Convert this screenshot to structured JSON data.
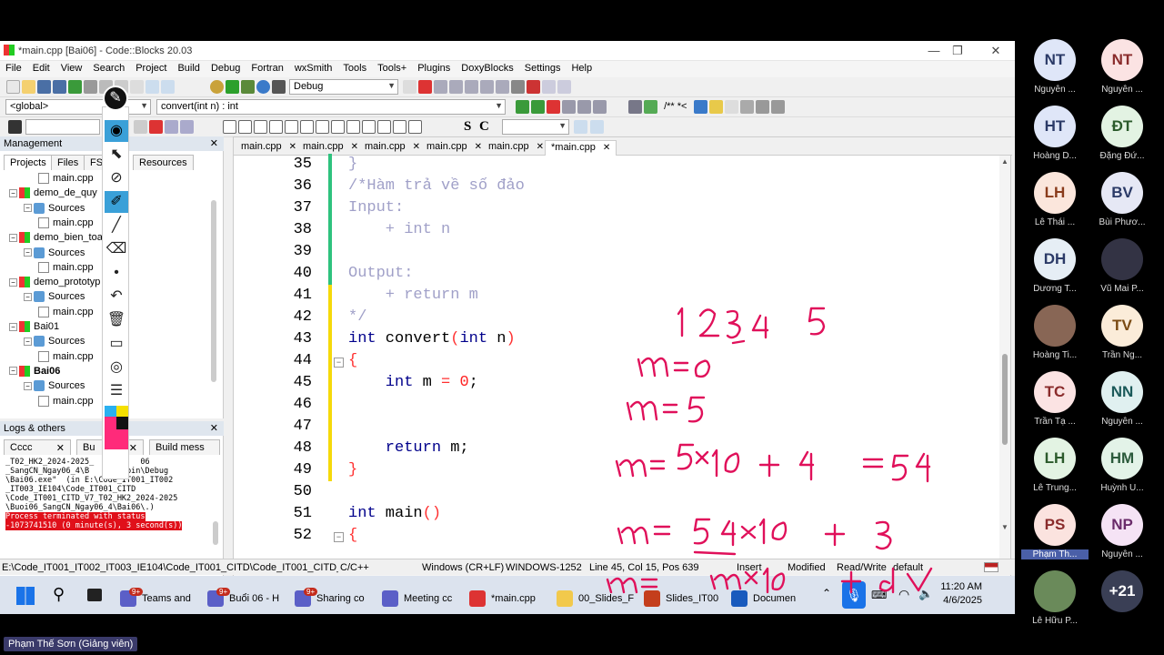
{
  "window": {
    "title": "*main.cpp [Bai06] - Code::Blocks 20.03"
  },
  "menu": [
    "File",
    "Edit",
    "View",
    "Search",
    "Project",
    "Build",
    "Debug",
    "Fortran",
    "wxSmith",
    "Tools",
    "Tools+",
    "Plugins",
    "DoxyBlocks",
    "Settings",
    "Help"
  ],
  "toolbar": {
    "build_target": "Debug",
    "scope": "<global>",
    "function": "convert(int n) : int",
    "comment_btn": "/** *<"
  },
  "management": {
    "title": "Management",
    "tabs": [
      "Projects",
      "Files",
      "FSy",
      "Resources"
    ],
    "tree": [
      {
        "label": "main.cpp",
        "type": "file",
        "indent": 2
      },
      {
        "label": "demo_de_quy",
        "type": "project",
        "indent": 0
      },
      {
        "label": "Sources",
        "type": "folder",
        "indent": 1
      },
      {
        "label": "main.cpp",
        "type": "file",
        "indent": 2
      },
      {
        "label": "demo_bien_toan",
        "type": "project",
        "indent": 0
      },
      {
        "label": "Sources",
        "type": "folder",
        "indent": 1
      },
      {
        "label": "main.cpp",
        "type": "file",
        "indent": 2
      },
      {
        "label": "demo_prototyp",
        "type": "project",
        "indent": 0
      },
      {
        "label": "Sources",
        "type": "folder",
        "indent": 1
      },
      {
        "label": "main.cpp",
        "type": "file",
        "indent": 2
      },
      {
        "label": "Bai01",
        "type": "project",
        "indent": 0
      },
      {
        "label": "Sources",
        "type": "folder",
        "indent": 1
      },
      {
        "label": "main.cpp",
        "type": "file",
        "indent": 2
      },
      {
        "label": "Bai06",
        "type": "project",
        "indent": 0,
        "bold": true
      },
      {
        "label": "Sources",
        "type": "folder",
        "indent": 1
      },
      {
        "label": "main.cpp",
        "type": "file",
        "indent": 2
      }
    ]
  },
  "logs": {
    "title": "Logs & others",
    "tabs": [
      "Cccc",
      "Bu",
      "Build mess"
    ],
    "lines": [
      "_T02_HK2_2024-2025_          06",
      "_SangCN_Ngay06_4\\B        bin\\Debug",
      "\\Bai06.exe\"  (in E:\\Code_IT001_IT002",
      "_IT003_IE104\\Code_IT001_CITD",
      "\\Code_IT001_CITD_V7_T02_HK2_2024-2025",
      "\\Buoi06_SangCN_Ngay06_4\\Bai06\\.)"
    ],
    "highlight": [
      "Process terminated with status",
      "-1073741510 (0 minute(s), 3 second(s))"
    ]
  },
  "editor": {
    "tabs": [
      "main.cpp",
      "main.cpp",
      "main.cpp",
      "main.cpp",
      "main.cpp",
      "*main.cpp"
    ],
    "lines": [
      {
        "n": "35",
        "t": "}",
        "c": "cm"
      },
      {
        "n": "36",
        "t": "/*Hàm trả về số đảo",
        "c": "cm"
      },
      {
        "n": "37",
        "t": "Input:",
        "c": "cm"
      },
      {
        "n": "38",
        "t": "    + int n",
        "c": "cm"
      },
      {
        "n": "39",
        "t": "",
        "c": "cm"
      },
      {
        "n": "40",
        "t": "Output:",
        "c": "cm"
      },
      {
        "n": "41",
        "t": "    + return m",
        "c": "cm"
      },
      {
        "n": "42",
        "t": "*/",
        "c": "cm"
      },
      {
        "n": "43",
        "t": "",
        "c": "code43"
      },
      {
        "n": "44",
        "t": "{",
        "c": "op"
      },
      {
        "n": "45",
        "t": "",
        "c": "code45"
      },
      {
        "n": "46",
        "t": "",
        "c": ""
      },
      {
        "n": "47",
        "t": "",
        "c": ""
      },
      {
        "n": "48",
        "t": "",
        "c": "code48"
      },
      {
        "n": "49",
        "t": "}",
        "c": "op"
      },
      {
        "n": "50",
        "t": "",
        "c": ""
      },
      {
        "n": "51",
        "t": "",
        "c": "code51"
      },
      {
        "n": "52",
        "t": "{",
        "c": "op"
      }
    ],
    "code43": {
      "kw1": "int",
      "fn": " convert",
      "p1": "(",
      "kw2": "int",
      "arg": " n",
      "p2": ")"
    },
    "code45": {
      "kw": "    int",
      "v": " m ",
      "eq": "=",
      "sp": " ",
      "num": "0",
      "semi": ";"
    },
    "code48": {
      "kw": "    return",
      "v": " m;"
    },
    "code51": {
      "kw": "int",
      "fn": " main",
      "p": "()"
    }
  },
  "status": {
    "path": "E:\\Code_IT001_IT002_IT003_IE104\\Code_IT001_CITD\\Code_IT001_CITD_V7_T02...",
    "lang": "C/C++",
    "eol": "Windows (CR+LF)",
    "enc": "WINDOWS-1252",
    "pos": "Line 45, Col 15, Pos 639",
    "mode": "Insert",
    "modified": "Modified",
    "rw": "Read/Write",
    "profile": "default"
  },
  "taskbar": {
    "apps": [
      {
        "label": "Teams and",
        "color": "#5b5fc7",
        "badge": "9+"
      },
      {
        "label": "Buổi 06 - H",
        "color": "#5b5fc7",
        "badge": "9+"
      },
      {
        "label": "Sharing co",
        "color": "#5b5fc7",
        "badge": "9+"
      },
      {
        "label": "Meeting cc",
        "color": "#5b5fc7",
        "badge": ""
      },
      {
        "label": "*main.cpp",
        "color": "#d33",
        "badge": ""
      },
      {
        "label": "00_Slides_F",
        "color": "#f2c94c",
        "badge": ""
      },
      {
        "label": "Slides_IT00",
        "color": "#c43e1c",
        "badge": ""
      },
      {
        "label": "Documen",
        "color": "#185abd",
        "badge": ""
      }
    ],
    "time": "11:20 AM",
    "date": "4/6/2025"
  },
  "participants": [
    {
      "initials": "NT",
      "name": "Nguyễn ...",
      "bg": "#dfe6f8",
      "fg": "#2b3a67"
    },
    {
      "initials": "NT",
      "name": "Nguyễn ...",
      "bg": "#fbe3e3",
      "fg": "#8a2b2b"
    },
    {
      "initials": "HT",
      "name": "Hoàng D...",
      "bg": "#dfe6f8",
      "fg": "#2b3a67"
    },
    {
      "initials": "ĐT",
      "name": "Đặng Đứ...",
      "bg": "#e3f3e3",
      "fg": "#2b5a2b"
    },
    {
      "initials": "LH",
      "name": "Lê Thái ...",
      "bg": "#fbe6dc",
      "fg": "#8a3b1b"
    },
    {
      "initials": "BV",
      "name": "Bùi Phươ...",
      "bg": "#e6e8f5",
      "fg": "#2b3a67"
    },
    {
      "initials": "DH",
      "name": "Dương T...",
      "bg": "#e6eef5",
      "fg": "#2b3a67"
    },
    {
      "initials": "",
      "name": "Vũ Mai P...",
      "bg": "#334",
      "fg": "#fff"
    },
    {
      "initials": "",
      "name": "Hoàng Ti...",
      "bg": "#865",
      "fg": "#fff"
    },
    {
      "initials": "TV",
      "name": "Trần Ng...",
      "bg": "#fbecd9",
      "fg": "#7a4a12"
    },
    {
      "initials": "TC",
      "name": "Trần Tạ ...",
      "bg": "#fbe3e3",
      "fg": "#8a2b2b"
    },
    {
      "initials": "NN",
      "name": "Nguyễn ...",
      "bg": "#e0f0f0",
      "fg": "#1b5a5a"
    },
    {
      "initials": "LH",
      "name": "Lê Trung...",
      "bg": "#e3f3e3",
      "fg": "#2b5a2b"
    },
    {
      "initials": "HM",
      "name": "Huỳnh U...",
      "bg": "#e3f3e8",
      "fg": "#2b5a3b"
    },
    {
      "initials": "PS",
      "name": "Phạm Th...",
      "bg": "#fbe3df",
      "fg": "#8a2b2b"
    },
    {
      "initials": "NP",
      "name": "Nguyễn ...",
      "bg": "#f5e3f5",
      "fg": "#6a2b6a"
    },
    {
      "initials": "",
      "name": "Lê Hữu P...",
      "bg": "#6a8a5a",
      "fg": "#fff"
    },
    {
      "initials": "+21",
      "name": "",
      "bg": "#3a3f55",
      "fg": "#fff"
    }
  ],
  "presenter": "Phạm Thế Sơn (Giảng viên)",
  "colors": {
    "ink": "#e0105a",
    "accent": "#3aa0d8",
    "comment": "#a0a0c8",
    "keyword": "#00008b"
  }
}
